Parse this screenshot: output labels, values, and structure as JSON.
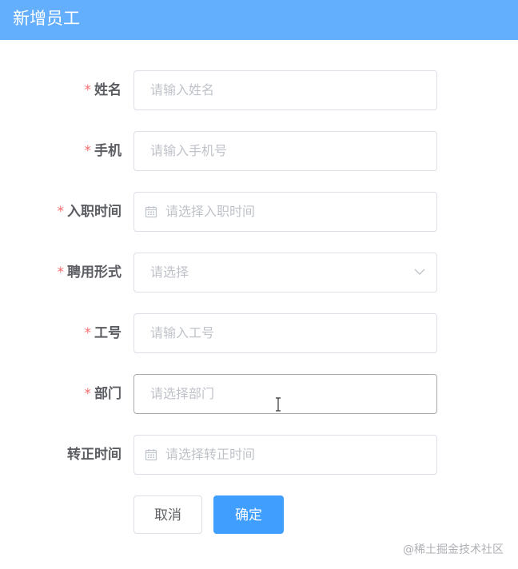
{
  "dialog": {
    "title": "新增员工"
  },
  "form": {
    "required_mark": "*",
    "fields": [
      {
        "label": "姓名",
        "required": true,
        "placeholder": "请输入姓名"
      },
      {
        "label": "手机",
        "required": true,
        "placeholder": "请输入手机号"
      },
      {
        "label": "入职时间",
        "required": true,
        "placeholder": "请选择入职时间",
        "icon": "calendar-icon"
      },
      {
        "label": "聘用形式",
        "required": true,
        "placeholder": "请选择",
        "icon": "chevron-down-icon"
      },
      {
        "label": "工号",
        "required": true,
        "placeholder": "请输入工号"
      },
      {
        "label": "部门",
        "required": true,
        "placeholder": "请选择部门"
      },
      {
        "label": "转正时间",
        "required": false,
        "placeholder": "请选择转正时间",
        "icon": "calendar-icon"
      }
    ]
  },
  "actions": {
    "cancel_label": "取消",
    "confirm_label": "确定"
  },
  "watermark": "@稀土掘金技术社区",
  "colors": {
    "header_bg": "#64aefe",
    "primary": "#409eff",
    "required": "#f56c6c",
    "label": "#5b5d62",
    "placeholder": "#bfc3c9",
    "border": "#dcdfe6"
  }
}
